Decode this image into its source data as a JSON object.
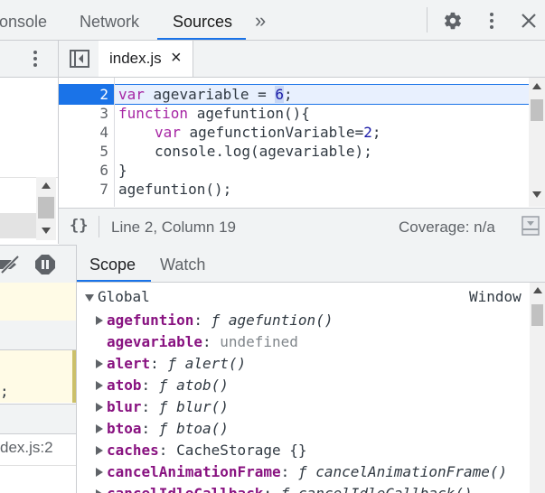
{
  "top_tabs": {
    "console": "onsole",
    "network": "Network",
    "sources": "Sources",
    "more": "»"
  },
  "editor": {
    "file_tab": "index.js",
    "file_tab_close": "×",
    "line_numbers": [
      "2",
      "3",
      "4",
      "5",
      "6",
      "7"
    ],
    "code": {
      "l2_kw": "var",
      "l2_a": " agevariable = ",
      "l2_num": "6",
      "l2_b": ";",
      "l3_kw": "function",
      "l3_a": " agefuntion(){",
      "l4_kw": "var",
      "l4_a": " agefunctionVariable=",
      "l4_num": "2",
      "l4_b": ";",
      "l5": "console.log(agevariable);",
      "l6": "}",
      "l7": "agefuntion();"
    },
    "status_braces": "{}",
    "status_position": "Line 2, Column 19",
    "status_coverage": "Coverage: n/a"
  },
  "left_fragments": {
    "semicolon": ";",
    "callstack_file": "dex.js:2"
  },
  "scope_tabs": {
    "scope": "Scope",
    "watch": "Watch"
  },
  "scope": {
    "global_label": "Global",
    "global_value": "Window",
    "rows": [
      {
        "name": "agefuntion",
        "sep": ": ",
        "f": "ƒ ",
        "val": "agefuntion()",
        "kind": "fn",
        "expand": true
      },
      {
        "name": "agevariable",
        "sep": ": ",
        "f": "",
        "val": "undefined",
        "kind": "undef",
        "expand": false
      },
      {
        "name": "alert",
        "sep": ": ",
        "f": "ƒ ",
        "val": "alert()",
        "kind": "fn",
        "expand": true
      },
      {
        "name": "atob",
        "sep": ": ",
        "f": "ƒ ",
        "val": "atob()",
        "kind": "fn",
        "expand": true
      },
      {
        "name": "blur",
        "sep": ": ",
        "f": "ƒ ",
        "val": "blur()",
        "kind": "fn",
        "expand": true
      },
      {
        "name": "btoa",
        "sep": ": ",
        "f": "ƒ ",
        "val": "btoa()",
        "kind": "fn",
        "expand": true
      },
      {
        "name": "caches",
        "sep": ": ",
        "f": "",
        "val": "CacheStorage {}",
        "kind": "obj",
        "expand": true
      },
      {
        "name": "cancelAnimationFrame",
        "sep": ": ",
        "f": "ƒ ",
        "val": "cancelAnimationFrame()",
        "kind": "fn",
        "expand": true
      },
      {
        "name": "cancelIdleCallback",
        "sep": ": ",
        "f": "ƒ ",
        "val": "cancelIdleCallback()",
        "kind": "fn",
        "expand": true
      }
    ]
  },
  "colors": {
    "accent": "#1a73e8",
    "exec_line": "#e8f0fe",
    "paused_yellow": "#fffbe6"
  }
}
